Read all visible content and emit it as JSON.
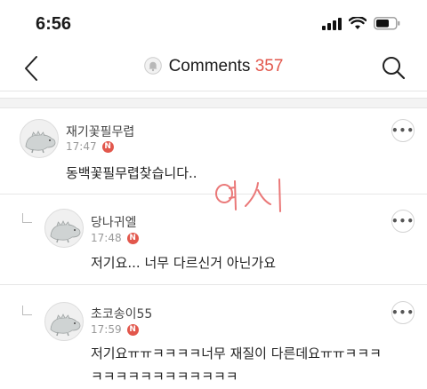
{
  "status_bar": {
    "time": "6:56"
  },
  "header": {
    "title": "Comments",
    "count": "357"
  },
  "comments": [
    {
      "author": "재기꽃필무렵",
      "time": "17:47",
      "badge": "N",
      "text": "동백꽃필무렵찾습니다..",
      "reply": false
    },
    {
      "author": "당나귀엘",
      "time": "17:48",
      "badge": "N",
      "text": "저기요... 너무 다르신거 아닌가요",
      "reply": true
    },
    {
      "author": "초코송이55",
      "time": "17:59",
      "badge": "N",
      "text_line1": "저기요ㅠㅠㅋㅋㅋㅋ너무 재질이 다른데요ㅠㅠㅋㅋㅋ",
      "text_line2": "ㅋㅋㅋㅋㅋㅋㅋㅋㅋㅋㅋㅋ",
      "reply": true
    }
  ],
  "annotation": {
    "handwritten": "여시",
    "color": "#e86a6a"
  },
  "colors": {
    "accent": "#e2574c"
  }
}
